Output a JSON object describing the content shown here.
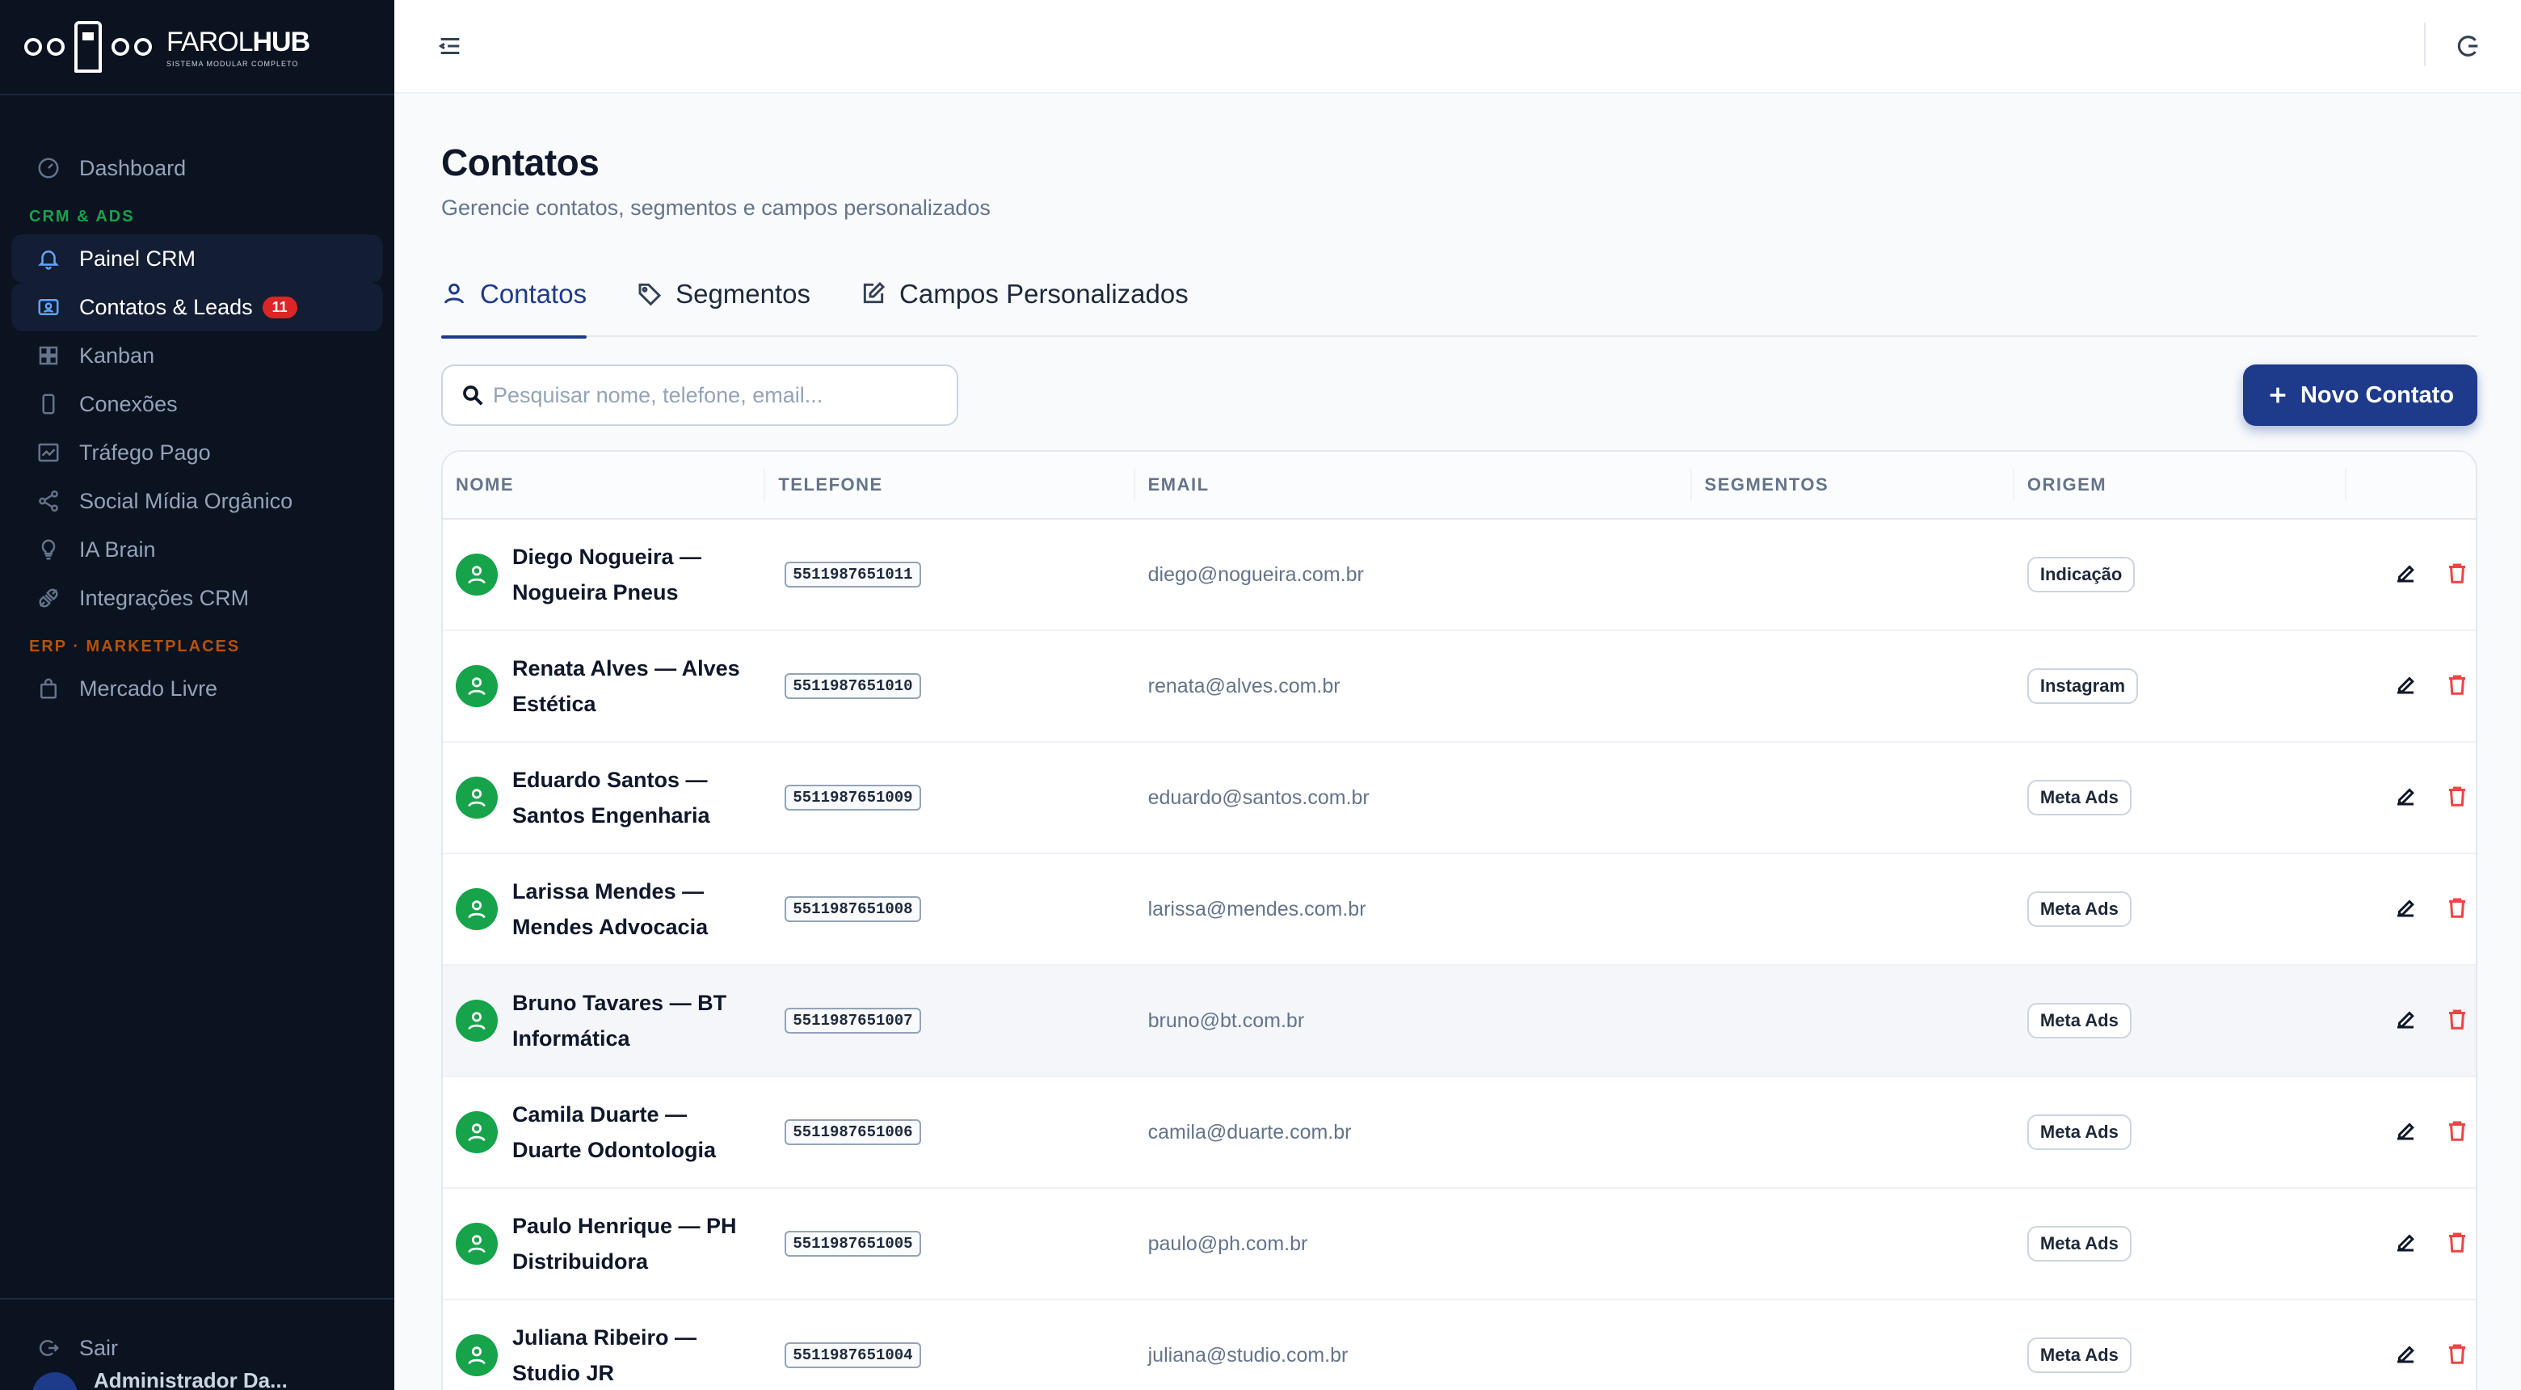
{
  "brand": {
    "name_light": "FAROL",
    "name_bold": "HUB",
    "subtitle": "SISTEMA MODULAR COMPLETO"
  },
  "sidebar": {
    "dashboard": "Dashboard",
    "section_crm": "CRM & ADS",
    "items_crm": [
      {
        "label": "Painel CRM",
        "icon": "bell-icon",
        "active": true
      },
      {
        "label": "Contatos & Leads",
        "icon": "contacts-icon",
        "active": true,
        "badge": "11"
      },
      {
        "label": "Kanban",
        "icon": "grid-icon"
      },
      {
        "label": "Conexões",
        "icon": "phone-icon"
      },
      {
        "label": "Tráfego Pago",
        "icon": "chart-icon"
      },
      {
        "label": "Social Mídia Orgânico",
        "icon": "share-icon"
      },
      {
        "label": "IA Brain",
        "icon": "lightbulb-icon"
      },
      {
        "label": "Integrações CRM",
        "icon": "plug-icon"
      }
    ],
    "section_erp": "ERP · MARKETPLACES",
    "items_erp": [
      {
        "label": "Mercado Livre",
        "icon": "bag-icon"
      }
    ],
    "logout": "Sair",
    "user_name": "Administrador Da..."
  },
  "page": {
    "title": "Contatos",
    "subtitle": "Gerencie contatos, segmentos e campos personalizados"
  },
  "tabs": [
    {
      "label": "Contatos",
      "icon": "user-icon",
      "active": true
    },
    {
      "label": "Segmentos",
      "icon": "tag-icon"
    },
    {
      "label": "Campos Personalizados",
      "icon": "edit-square-icon"
    }
  ],
  "search": {
    "placeholder": "Pesquisar nome, telefone, email...",
    "value": ""
  },
  "new_button": "Novo Contato",
  "table": {
    "headers": [
      "NOME",
      "TELEFONE",
      "EMAIL",
      "SEGMENTOS",
      "ORIGEM"
    ],
    "rows": [
      {
        "name": "Diego Nogueira — Nogueira Pneus",
        "phone": "5511987651011",
        "email": "diego@nogueira.com.br",
        "segments": "",
        "origin": "Indicação"
      },
      {
        "name": "Renata Alves — Alves Estética",
        "phone": "5511987651010",
        "email": "renata@alves.com.br",
        "segments": "",
        "origin": "Instagram"
      },
      {
        "name": "Eduardo Santos — Santos Engenharia",
        "phone": "5511987651009",
        "email": "eduardo@santos.com.br",
        "segments": "",
        "origin": "Meta Ads"
      },
      {
        "name": "Larissa Mendes — Mendes Advocacia",
        "phone": "5511987651008",
        "email": "larissa@mendes.com.br",
        "segments": "",
        "origin": "Meta Ads"
      },
      {
        "name": "Bruno Tavares — BT Informática",
        "phone": "5511987651007",
        "email": "bruno@bt.com.br",
        "segments": "",
        "origin": "Meta Ads"
      },
      {
        "name": "Camila Duarte — Duarte Odontologia",
        "phone": "5511987651006",
        "email": "camila@duarte.com.br",
        "segments": "",
        "origin": "Meta Ads"
      },
      {
        "name": "Paulo Henrique — PH Distribuidora",
        "phone": "5511987651005",
        "email": "paulo@ph.com.br",
        "segments": "",
        "origin": "Meta Ads"
      },
      {
        "name": "Juliana Ribeiro — Studio JR",
        "phone": "5511987651004",
        "email": "juliana@studio.com.br",
        "segments": "",
        "origin": "Meta Ads"
      }
    ]
  }
}
